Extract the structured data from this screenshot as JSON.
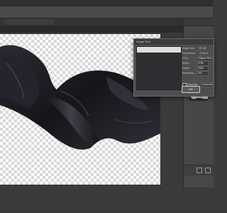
{
  "dialog": {
    "title": "Image Size",
    "image_size_label": "Image Size:",
    "image_size_value": "82.4M",
    "dimensions_label": "Dimensions:",
    "dimensions_value": "4736 px",
    "fit_to_label": "Fit To:",
    "fit_to_value": "Original Size",
    "width_label": "Width:",
    "width_value": "4736",
    "width_unit": "Pixels",
    "height_label": "Height:",
    "height_value": "2656",
    "height_unit": "Pixels",
    "resolution_label": "Resolution:",
    "resolution_value": "300",
    "resolution_unit": "Pixels/Inch",
    "resample_label": "Resample:",
    "resample_value": "Automatic",
    "ok_label": "OK"
  },
  "colors": {
    "app_bg": "#3b3b3b",
    "panel_bg": "#474747",
    "dialog_bg": "#4e4e4e",
    "silk": "#1c1c22"
  },
  "icons": [
    "new-layer-icon",
    "trash-icon",
    "layer-thumbnail-icon"
  ]
}
